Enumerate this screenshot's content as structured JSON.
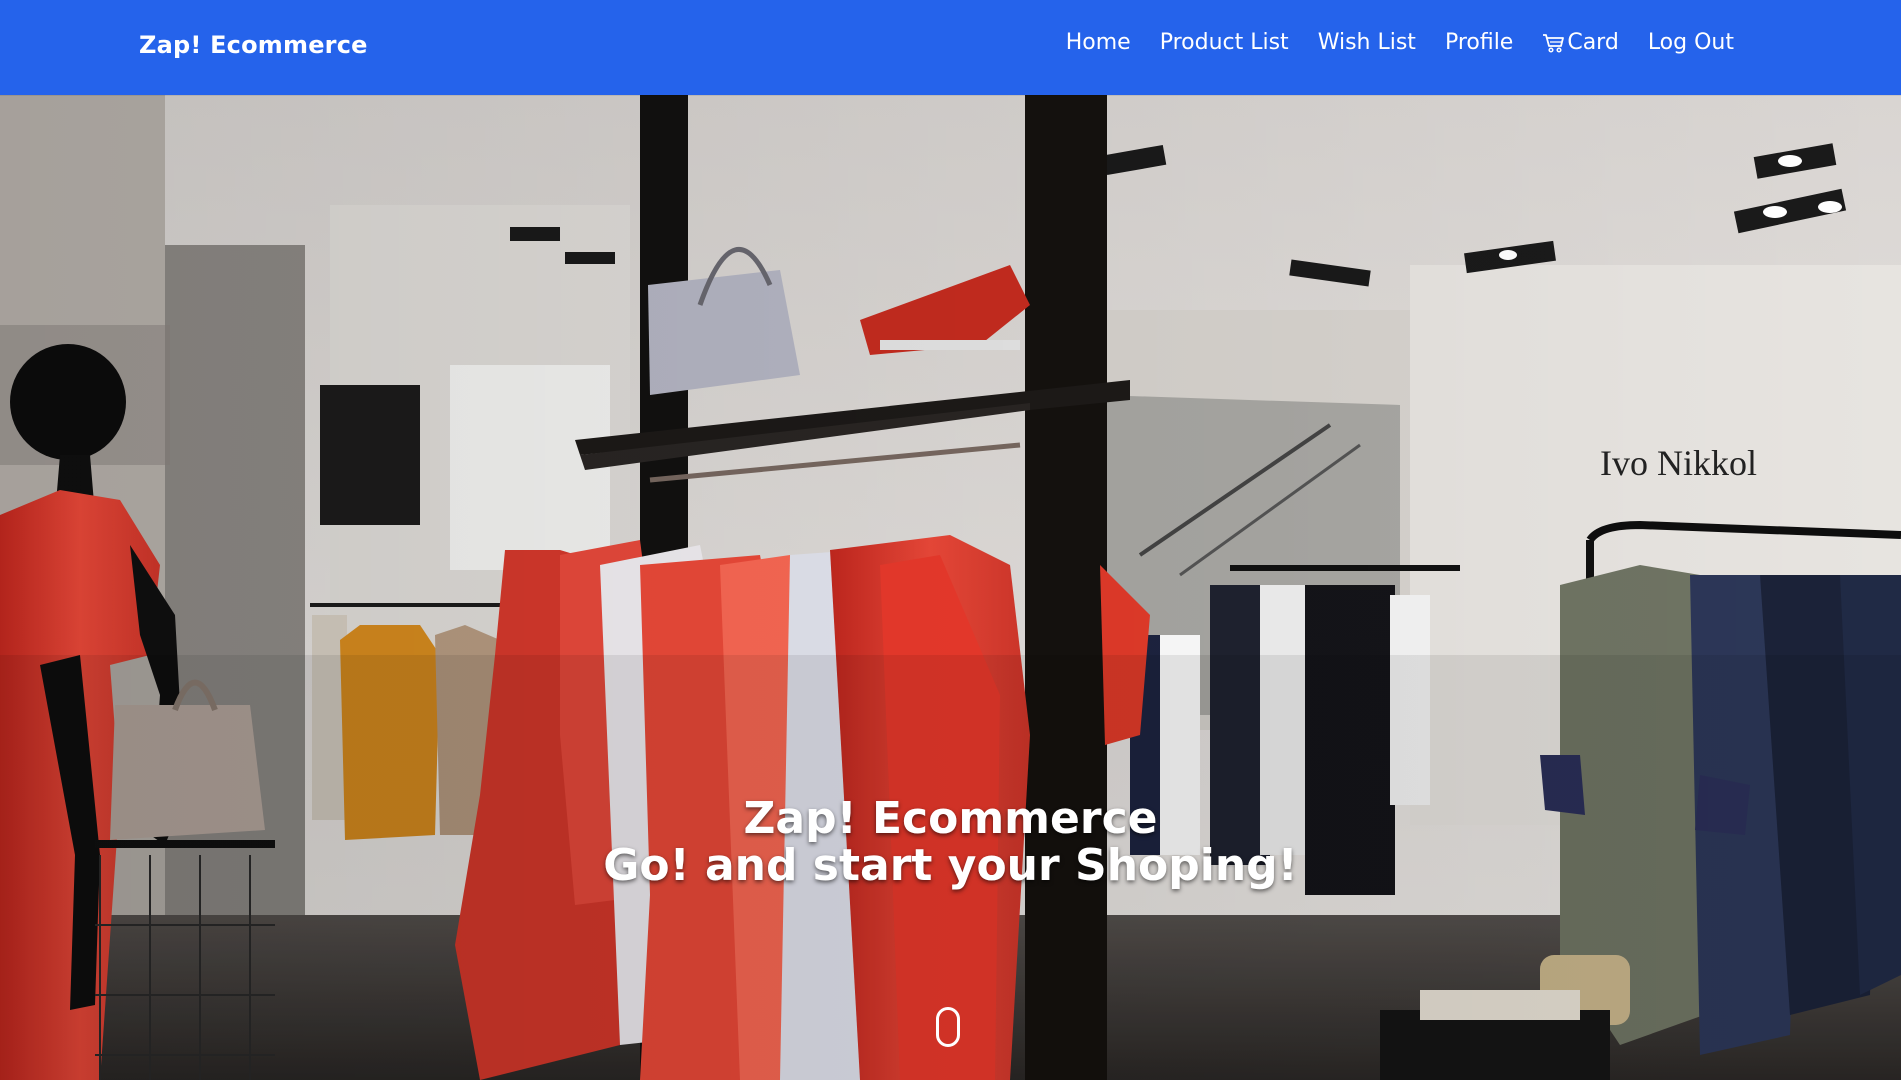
{
  "navbar": {
    "brand": "Zap! Ecommerce",
    "links": [
      {
        "label": "Home"
      },
      {
        "label": "Product List"
      },
      {
        "label": "Wish List"
      },
      {
        "label": "Profile"
      },
      {
        "label": "Card",
        "icon": "cart-icon"
      },
      {
        "label": "Log Out"
      }
    ]
  },
  "hero": {
    "title": "Zap! Ecommerce",
    "subtitle": "Go! and start your Shoping!",
    "store_sign": "Ivo Nikkol",
    "scroll_icon": "mouse-scroll-icon"
  },
  "colors": {
    "navbar_bg": "#2563eb",
    "text": "#ffffff"
  }
}
